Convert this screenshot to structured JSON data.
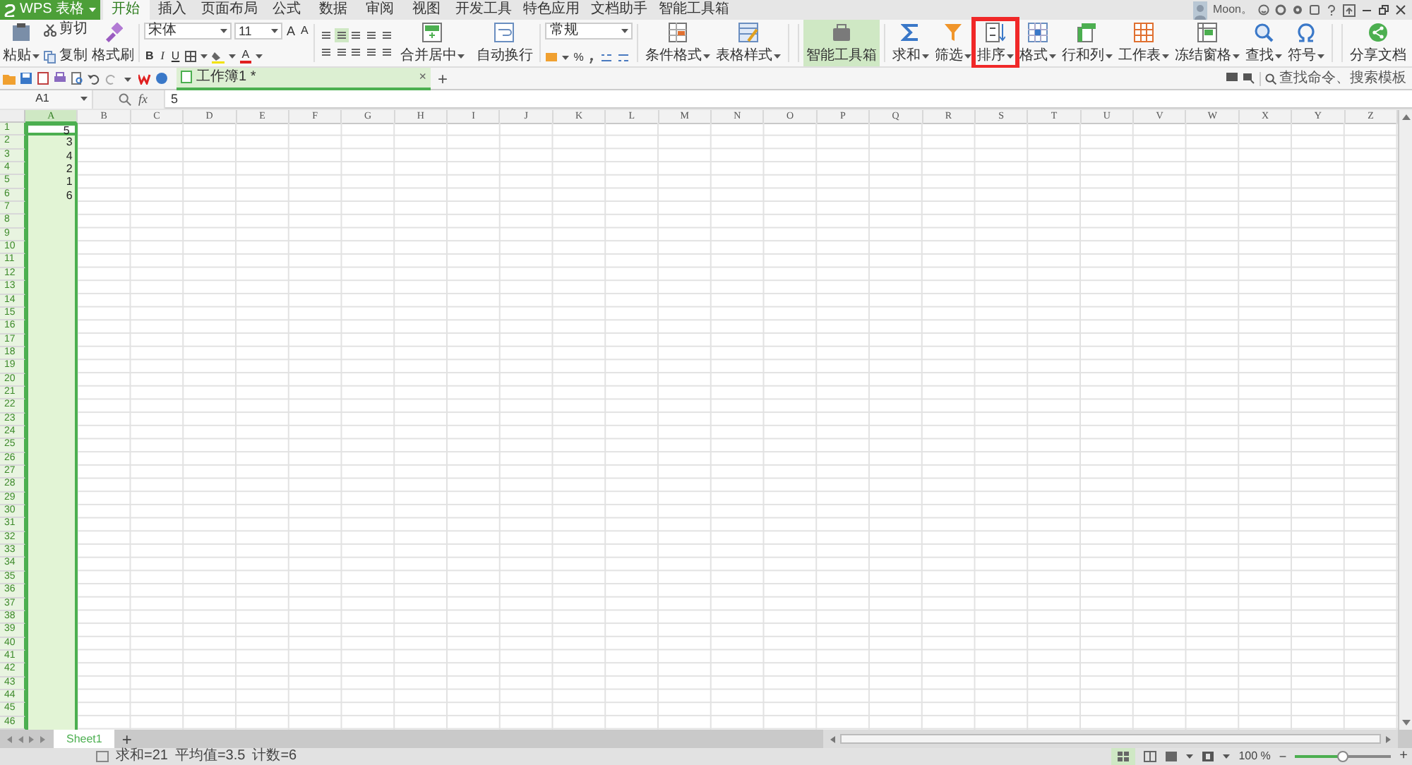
{
  "app_button": {
    "label": "WPS 表格"
  },
  "ribbon_tabs": [
    {
      "label": "开始",
      "selected": true
    },
    {
      "label": "插入",
      "selected": false
    },
    {
      "label": "页面布局",
      "selected": false
    },
    {
      "label": "公式",
      "selected": false
    },
    {
      "label": "数据",
      "selected": false
    },
    {
      "label": "审阅",
      "selected": false
    },
    {
      "label": "视图",
      "selected": false
    },
    {
      "label": "开发工具",
      "selected": false
    },
    {
      "label": "特色应用",
      "selected": false
    },
    {
      "label": "文档助手",
      "selected": false
    },
    {
      "label": "智能工具箱",
      "selected": false
    }
  ],
  "account": {
    "name": "Moon。"
  },
  "clipboard": {
    "paste": "粘贴",
    "cut": "剪切",
    "copy": "复制",
    "format_painter": "格式刷"
  },
  "font": {
    "name": "宋体",
    "size": "11",
    "format_buttons": [
      "B",
      "I",
      "U"
    ],
    "grow": "A",
    "shrink": "A",
    "font_color_button": "A"
  },
  "alignment": {
    "merge": "合并居中",
    "wrap": "自动换行"
  },
  "number": {
    "format": "常规",
    "percent": "%"
  },
  "large_buttons": [
    {
      "label": "条件格式",
      "dropdown": true,
      "selected": false,
      "highlighted": false
    },
    {
      "label": "表格样式",
      "dropdown": true,
      "selected": false,
      "highlighted": false
    },
    {
      "label": "智能工具箱",
      "dropdown": false,
      "selected": true,
      "highlighted": false
    },
    {
      "label": "求和",
      "dropdown": true,
      "selected": false,
      "highlighted": false
    },
    {
      "label": "筛选",
      "dropdown": true,
      "selected": false,
      "highlighted": false
    },
    {
      "label": "排序",
      "dropdown": true,
      "selected": false,
      "highlighted": true
    },
    {
      "label": "格式",
      "dropdown": true,
      "selected": false,
      "highlighted": false
    },
    {
      "label": "行和列",
      "dropdown": true,
      "selected": false,
      "highlighted": false
    },
    {
      "label": "工作表",
      "dropdown": true,
      "selected": false,
      "highlighted": false
    },
    {
      "label": "冻结窗格",
      "dropdown": true,
      "selected": false,
      "highlighted": false
    },
    {
      "label": "查找",
      "dropdown": true,
      "selected": false,
      "highlighted": false
    },
    {
      "label": "符号",
      "dropdown": true,
      "selected": false,
      "highlighted": false
    },
    {
      "label": "分享文档",
      "dropdown": false,
      "selected": false,
      "highlighted": false
    }
  ],
  "document_tab": {
    "title": "工作簿1 *",
    "close": "×",
    "add": "+"
  },
  "search": {
    "placeholder": "查找命令、搜索模板"
  },
  "formula_bar": {
    "name_box": "A1",
    "fx": "fx",
    "value": "5"
  },
  "sheet": {
    "columns": [
      {
        "label": "A",
        "selected": true
      },
      {
        "label": "B",
        "selected": false
      },
      {
        "label": "C",
        "selected": false
      },
      {
        "label": "D",
        "selected": false
      },
      {
        "label": "E",
        "selected": false
      },
      {
        "label": "F",
        "selected": false
      },
      {
        "label": "G",
        "selected": false
      },
      {
        "label": "H",
        "selected": false
      },
      {
        "label": "I",
        "selected": false
      },
      {
        "label": "J",
        "selected": false
      },
      {
        "label": "K",
        "selected": false
      },
      {
        "label": "L",
        "selected": false
      },
      {
        "label": "M",
        "selected": false
      },
      {
        "label": "N",
        "selected": false
      },
      {
        "label": "O",
        "selected": false
      },
      {
        "label": "P",
        "selected": false
      },
      {
        "label": "Q",
        "selected": false
      },
      {
        "label": "R",
        "selected": false
      },
      {
        "label": "S",
        "selected": false
      },
      {
        "label": "T",
        "selected": false
      },
      {
        "label": "U",
        "selected": false
      },
      {
        "label": "V",
        "selected": false
      },
      {
        "label": "W",
        "selected": false
      },
      {
        "label": "X",
        "selected": false
      },
      {
        "label": "Y",
        "selected": false
      },
      {
        "label": "Z",
        "selected": false
      }
    ],
    "rows": [
      {
        "label": "1",
        "cells": [
          {
            "value": "5",
            "selected": true
          }
        ]
      },
      {
        "label": "2",
        "cells": [
          {
            "value": "3",
            "selected": false
          }
        ]
      },
      {
        "label": "3",
        "cells": [
          {
            "value": "4",
            "selected": false
          }
        ]
      },
      {
        "label": "4",
        "cells": [
          {
            "value": "2",
            "selected": false
          }
        ]
      },
      {
        "label": "5",
        "cells": [
          {
            "value": "1",
            "selected": false
          }
        ]
      },
      {
        "label": "6",
        "cells": [
          {
            "value": "6",
            "selected": false
          }
        ]
      },
      {
        "label": "7"
      },
      {
        "label": "8"
      },
      {
        "label": "9"
      },
      {
        "label": "10"
      },
      {
        "label": "11"
      },
      {
        "label": "12"
      },
      {
        "label": "13"
      },
      {
        "label": "14"
      },
      {
        "label": "15"
      },
      {
        "label": "16"
      },
      {
        "label": "17"
      },
      {
        "label": "18"
      },
      {
        "label": "19"
      },
      {
        "label": "20"
      },
      {
        "label": "21"
      },
      {
        "label": "22"
      },
      {
        "label": "23"
      },
      {
        "label": "24"
      },
      {
        "label": "25"
      },
      {
        "label": "26"
      },
      {
        "label": "27"
      },
      {
        "label": "28"
      },
      {
        "label": "29"
      },
      {
        "label": "30"
      },
      {
        "label": "31"
      },
      {
        "label": "32"
      },
      {
        "label": "33"
      },
      {
        "label": "34"
      },
      {
        "label": "35"
      },
      {
        "label": "36"
      },
      {
        "label": "37"
      },
      {
        "label": "38"
      },
      {
        "label": "39"
      },
      {
        "label": "40"
      },
      {
        "label": "41"
      },
      {
        "label": "42"
      },
      {
        "label": "43"
      },
      {
        "label": "44"
      },
      {
        "label": "45"
      },
      {
        "label": "46"
      }
    ]
  },
  "sheet_tabs": [
    {
      "label": "Sheet1",
      "selected": true
    }
  ],
  "add_sheet": "+",
  "status_bar": {
    "sum": "求和=21",
    "average": "平均值=3.5",
    "count": "计数=6",
    "zoom": "100 %",
    "zoom_slider": {
      "level": 0.5
    },
    "zoom_out": "−",
    "zoom_in": "+"
  }
}
